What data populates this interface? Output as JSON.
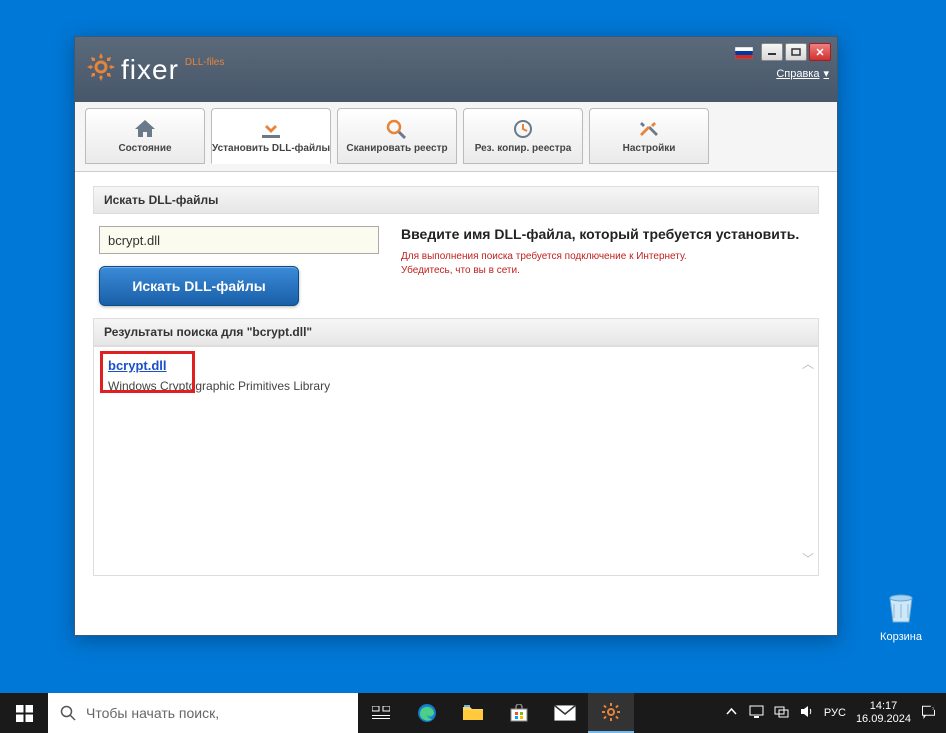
{
  "app": {
    "brand_small": "DLL-files",
    "brand": "fixer",
    "help_link": "Справка",
    "tabs": [
      {
        "label": "Состояние"
      },
      {
        "label": "Установить DLL-файлы"
      },
      {
        "label": "Сканировать реестр"
      },
      {
        "label": "Рез. копир. реестра"
      },
      {
        "label": "Настройки"
      }
    ],
    "search": {
      "header": "Искать DLL-файлы",
      "input_value": "bcrypt.dll",
      "button": "Искать DLL-файлы",
      "instruction_title": "Введите имя DLL-файла, который требуется установить.",
      "instruction_warn1": "Для выполнения поиска требуется подключение к Интернету.",
      "instruction_warn2": "Убедитесь, что вы в сети."
    },
    "results": {
      "header": "Результаты поиска для \"bcrypt.dll\"",
      "link": "bcrypt.dll",
      "desc": "Windows Cryptographic Primitives Library"
    }
  },
  "desktop": {
    "recycle_label": "Корзина"
  },
  "taskbar": {
    "search_placeholder": "Чтобы начать поиск,",
    "lang": "РУС",
    "time": "14:17",
    "date": "16.09.2024"
  }
}
